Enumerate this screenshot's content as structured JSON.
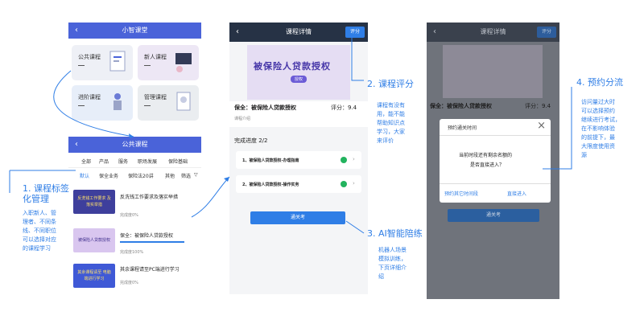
{
  "screen1": {
    "title": "小智课堂",
    "tiles": [
      "公共课程",
      "新人课程",
      "进阶课程",
      "管理课程"
    ]
  },
  "screen2": {
    "title": "公共课程",
    "categories": [
      "全部",
      "产品",
      "服务",
      "职场发展",
      "保险基础"
    ],
    "subtabs": [
      "默认",
      "保全业务",
      "保险法20讲",
      "其他",
      "筛选"
    ],
    "filter_icon": "filter-icon",
    "items": [
      {
        "title": "反洗钱工作要求及落实举措",
        "progress": "完成度0%",
        "thumb_text": "反洗钱工作要求 及落实举措"
      },
      {
        "title": "保全：被保险人贷款授权",
        "progress": "完成度100%",
        "thumb_text": "被保险人贷款授权"
      },
      {
        "title": "其余课程请至PC端进行学习",
        "progress": "完成度0%",
        "thumb_text": "其余课程请至 电脑端进行学习"
      }
    ]
  },
  "screen3": {
    "title": "课程详情",
    "rate_button": "评分",
    "banner_title": "被保险人贷款授权",
    "banner_sub": "授权",
    "course_title": "保全：被保险人贷款授权",
    "score_label": "评分：9.4",
    "intro": "课程介绍",
    "progress_label": "完成进度 2/2",
    "steps": [
      "1、被保险人贷款授权-办理指南",
      "2、被保险人贷款授权-操作实务"
    ],
    "exam_button": "通关考"
  },
  "screen4": {
    "title": "课程详情",
    "rate_button": "评分",
    "course_title": "保全：被保险人贷款授权",
    "score_label": "评分：9.4",
    "dialog": {
      "title": "预约通关时间",
      "line1": "当前时段还有剩余名额的",
      "line2": "是否直接进入？",
      "btn_reserve": "预约其它时间段",
      "btn_enter": "直接进入"
    },
    "exam_button": "通关考"
  },
  "annotations": {
    "a1_title_1": "1. 课程标签",
    "a1_title_2": "化管理",
    "a1_text": [
      "入职新人、管",
      "理者、不同条",
      "线、不同职位",
      "可以选择对应",
      "的课程学习"
    ],
    "a2_title": "2. 课程评分",
    "a2_text": [
      "课程有没有",
      "用，能不能",
      "帮助知识点",
      "学习，大家",
      "来评价"
    ],
    "a3_title": "3. AI智能陪练",
    "a3_text": [
      "机器人场景",
      "模拟训练，",
      "下页详细介",
      "绍"
    ],
    "a4_title": "4. 预约分流",
    "a4_text": [
      "访问量过大时",
      "可以选择预约",
      "继续进行考试，",
      "在不影响体验",
      "的前提下，最",
      "大限度使用资",
      "源"
    ]
  },
  "colors": {
    "accent": "#2f7ee6",
    "header_blue": "#4a63d9",
    "header_dark": "#263245",
    "success": "#22b35e"
  }
}
